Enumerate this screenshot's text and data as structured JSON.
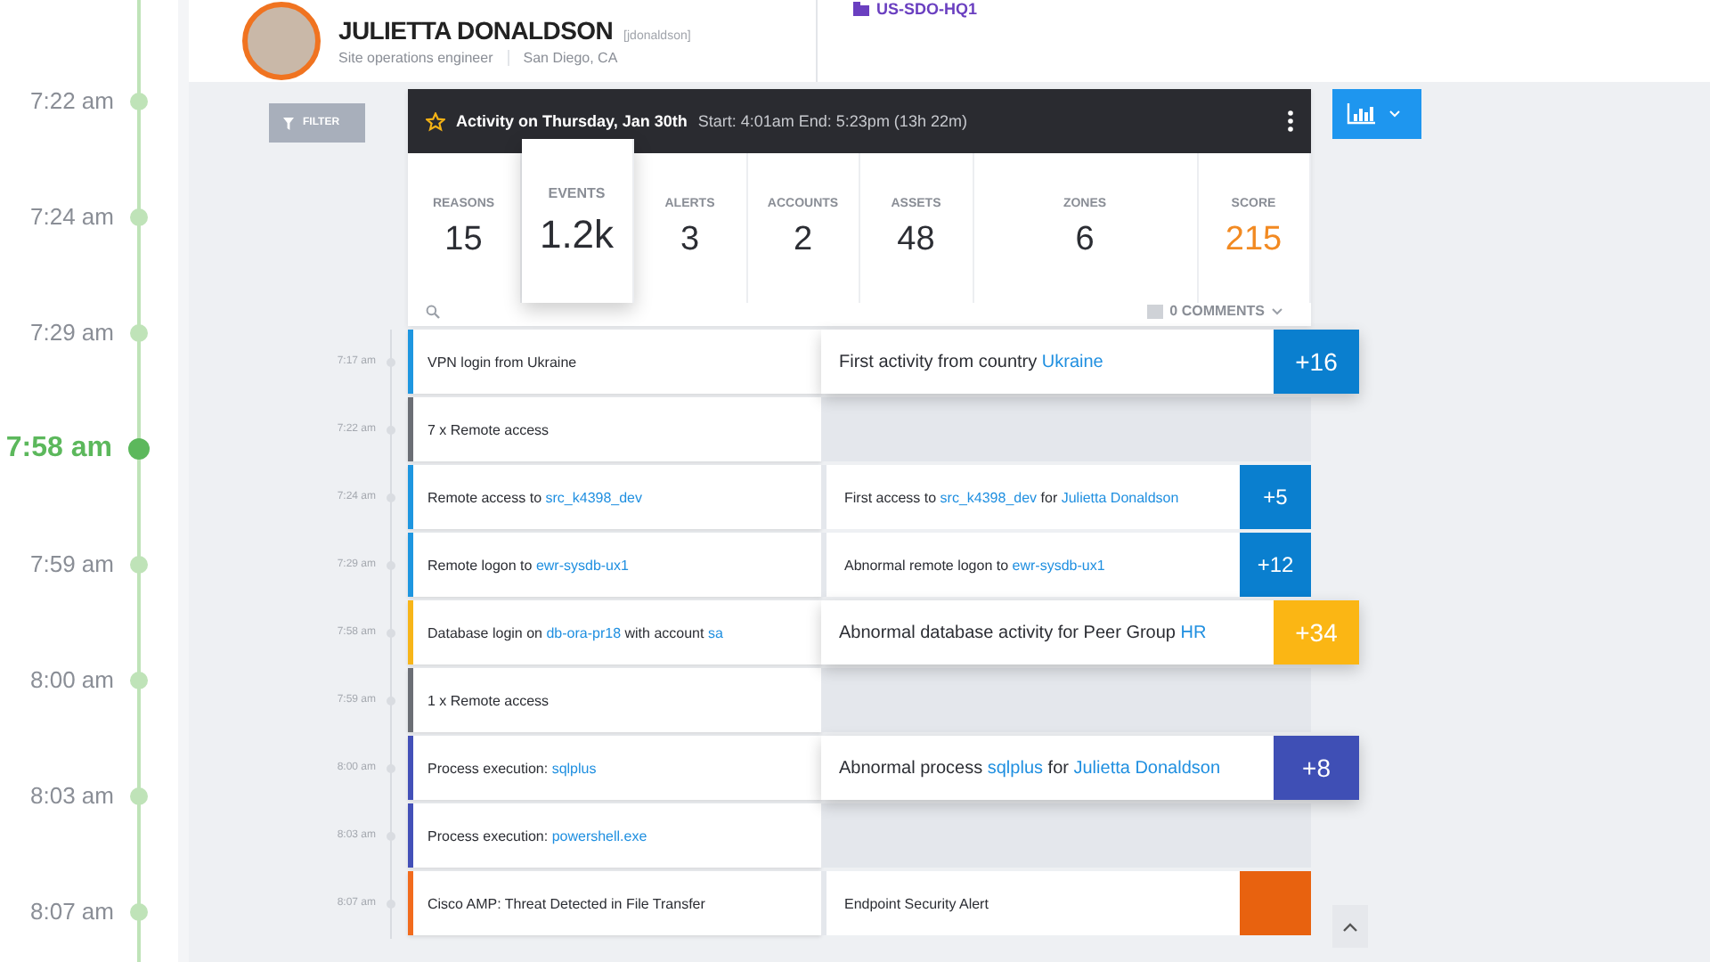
{
  "timeline": [
    {
      "time": "7:22 am",
      "selected": false
    },
    {
      "time": "7:24 am",
      "selected": false
    },
    {
      "time": "7:29 am",
      "selected": false
    },
    {
      "time": "7:58 am",
      "selected": true
    },
    {
      "time": "7:59 am",
      "selected": false
    },
    {
      "time": "8:00 am",
      "selected": false
    },
    {
      "time": "8:03 am",
      "selected": false
    },
    {
      "time": "8:07 am",
      "selected": false
    }
  ],
  "profile": {
    "name": "JULIETTA DONALDSON",
    "username": "[jdonaldson]",
    "title": "Site operations engineer",
    "location": "San Diego, CA",
    "site": "US-SDO-HQ1"
  },
  "filter_button": "FILTER",
  "activity": {
    "title": "Activity on Thursday, Jan 30th",
    "range": "Start: 4:01am End: 5:23pm (13h 22m)",
    "stats": [
      {
        "label": "REASONS",
        "value": "15",
        "selected": false,
        "kind": "count"
      },
      {
        "label": "EVENTS",
        "value": "1.2k",
        "selected": true,
        "kind": "count"
      },
      {
        "label": "ALERTS",
        "value": "3",
        "selected": false,
        "kind": "count"
      },
      {
        "label": "ACCOUNTS",
        "value": "2",
        "selected": false,
        "kind": "count"
      },
      {
        "label": "ASSETS",
        "value": "48",
        "selected": false,
        "kind": "count"
      },
      {
        "label": "ZONES",
        "value": "6",
        "selected": false,
        "kind": "count"
      },
      {
        "label": "SCORE",
        "value": "215",
        "selected": false,
        "kind": "score"
      }
    ],
    "comments": "0 COMMENTS"
  },
  "events": [
    {
      "time": "7:17 am",
      "color": "#1e96e0",
      "text": [
        {
          "text": "VPN login from Ukraine",
          "link": false
        }
      ],
      "reason": {
        "kind": "major",
        "color": "#0a7fcf",
        "score": "+16",
        "text": [
          {
            "text": "First activity from country ",
            "link": false
          },
          {
            "text": "Ukraine",
            "link": true
          }
        ]
      }
    },
    {
      "time": "7:22 am",
      "color": "#6b6e75",
      "text": [
        {
          "text": "7 x Remote access",
          "link": false
        }
      ]
    },
    {
      "time": "7:24 am",
      "color": "#1e96e0",
      "text": [
        {
          "text": "Remote access to ",
          "link": false
        },
        {
          "text": "src_k4398_dev",
          "link": true
        }
      ],
      "reason": {
        "kind": "minor",
        "color": "#0a7fcf",
        "score": "+5",
        "text": [
          {
            "text": "First access to ",
            "link": false
          },
          {
            "text": "src_k4398_dev",
            "link": true
          },
          {
            "text": " for ",
            "link": false
          },
          {
            "text": "Julietta Donaldson",
            "link": true
          }
        ]
      }
    },
    {
      "time": "7:29 am",
      "color": "#1e96e0",
      "text": [
        {
          "text": "Remote logon to ",
          "link": false
        },
        {
          "text": "ewr-sysdb-ux1",
          "link": true
        }
      ],
      "reason": {
        "kind": "minor",
        "color": "#0a7fcf",
        "score": "+12",
        "text": [
          {
            "text": "Abnormal remote logon to ",
            "link": false
          },
          {
            "text": "ewr-sysdb-ux1",
            "link": true
          }
        ]
      }
    },
    {
      "time": "7:58 am",
      "color": "#f7b519",
      "text": [
        {
          "text": "Database login on ",
          "link": false
        },
        {
          "text": "db-ora-pr18",
          "link": true
        },
        {
          "text": " with account ",
          "link": false
        },
        {
          "text": "sa",
          "link": true
        }
      ],
      "reason": {
        "kind": "major",
        "color": "#fbb614",
        "score": "+34",
        "text": [
          {
            "text": "Abnormal database activity for Peer Group ",
            "link": false
          },
          {
            "text": "HR",
            "link": true
          }
        ]
      }
    },
    {
      "time": "7:59 am",
      "color": "#6b6e75",
      "text": [
        {
          "text": "1 x Remote access",
          "link": false
        }
      ]
    },
    {
      "time": "8:00 am",
      "color": "#4350b8",
      "text": [
        {
          "text": "Process execution: ",
          "link": false
        },
        {
          "text": "sqlplus",
          "link": true
        }
      ],
      "reason": {
        "kind": "major",
        "color": "#3f4fb5",
        "score": "+8",
        "text": [
          {
            "text": "Abnormal process ",
            "link": false
          },
          {
            "text": "sqlplus",
            "link": true
          },
          {
            "text": " for ",
            "link": false
          },
          {
            "text": "Julietta Donaldson",
            "link": true
          }
        ]
      }
    },
    {
      "time": "8:03 am",
      "color": "#4350b8",
      "text": [
        {
          "text": "Process execution: ",
          "link": false
        },
        {
          "text": "powershell.exe",
          "link": true
        }
      ]
    },
    {
      "time": "8:07 am",
      "color": "#f26b1d",
      "text": [
        {
          "text": "Cisco AMP:  Threat Detected in File Transfer",
          "link": false
        }
      ],
      "reason": {
        "kind": "minor",
        "color": "#e8620f",
        "text": [
          {
            "text": "Endpoint Security Alert",
            "link": false
          }
        ]
      }
    }
  ]
}
